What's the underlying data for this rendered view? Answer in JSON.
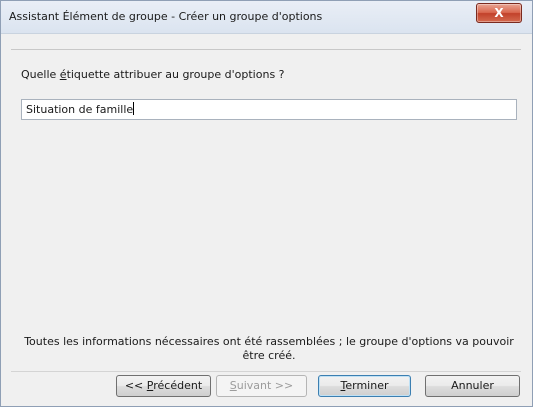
{
  "window": {
    "title": "Assistant Élément de groupe - Créer un groupe d'options",
    "close_glyph": "X"
  },
  "prompt": {
    "before": "Quelle ",
    "mnemonic": "é",
    "after": "tiquette attribuer au groupe d'options ?"
  },
  "label_input": {
    "value": "Situation de famille"
  },
  "info_text": "Toutes les informations nécessaires ont été rassemblées ; le groupe d'options va pouvoir être créé.",
  "buttons": {
    "previous": {
      "prefix": "<< ",
      "mnemonic": "P",
      "rest": "récédent"
    },
    "next": {
      "mnemonic": "S",
      "rest": "uivant >>"
    },
    "finish": {
      "mnemonic": "T",
      "rest": "erminer"
    },
    "cancel": {
      "label": "Annuler"
    }
  }
}
